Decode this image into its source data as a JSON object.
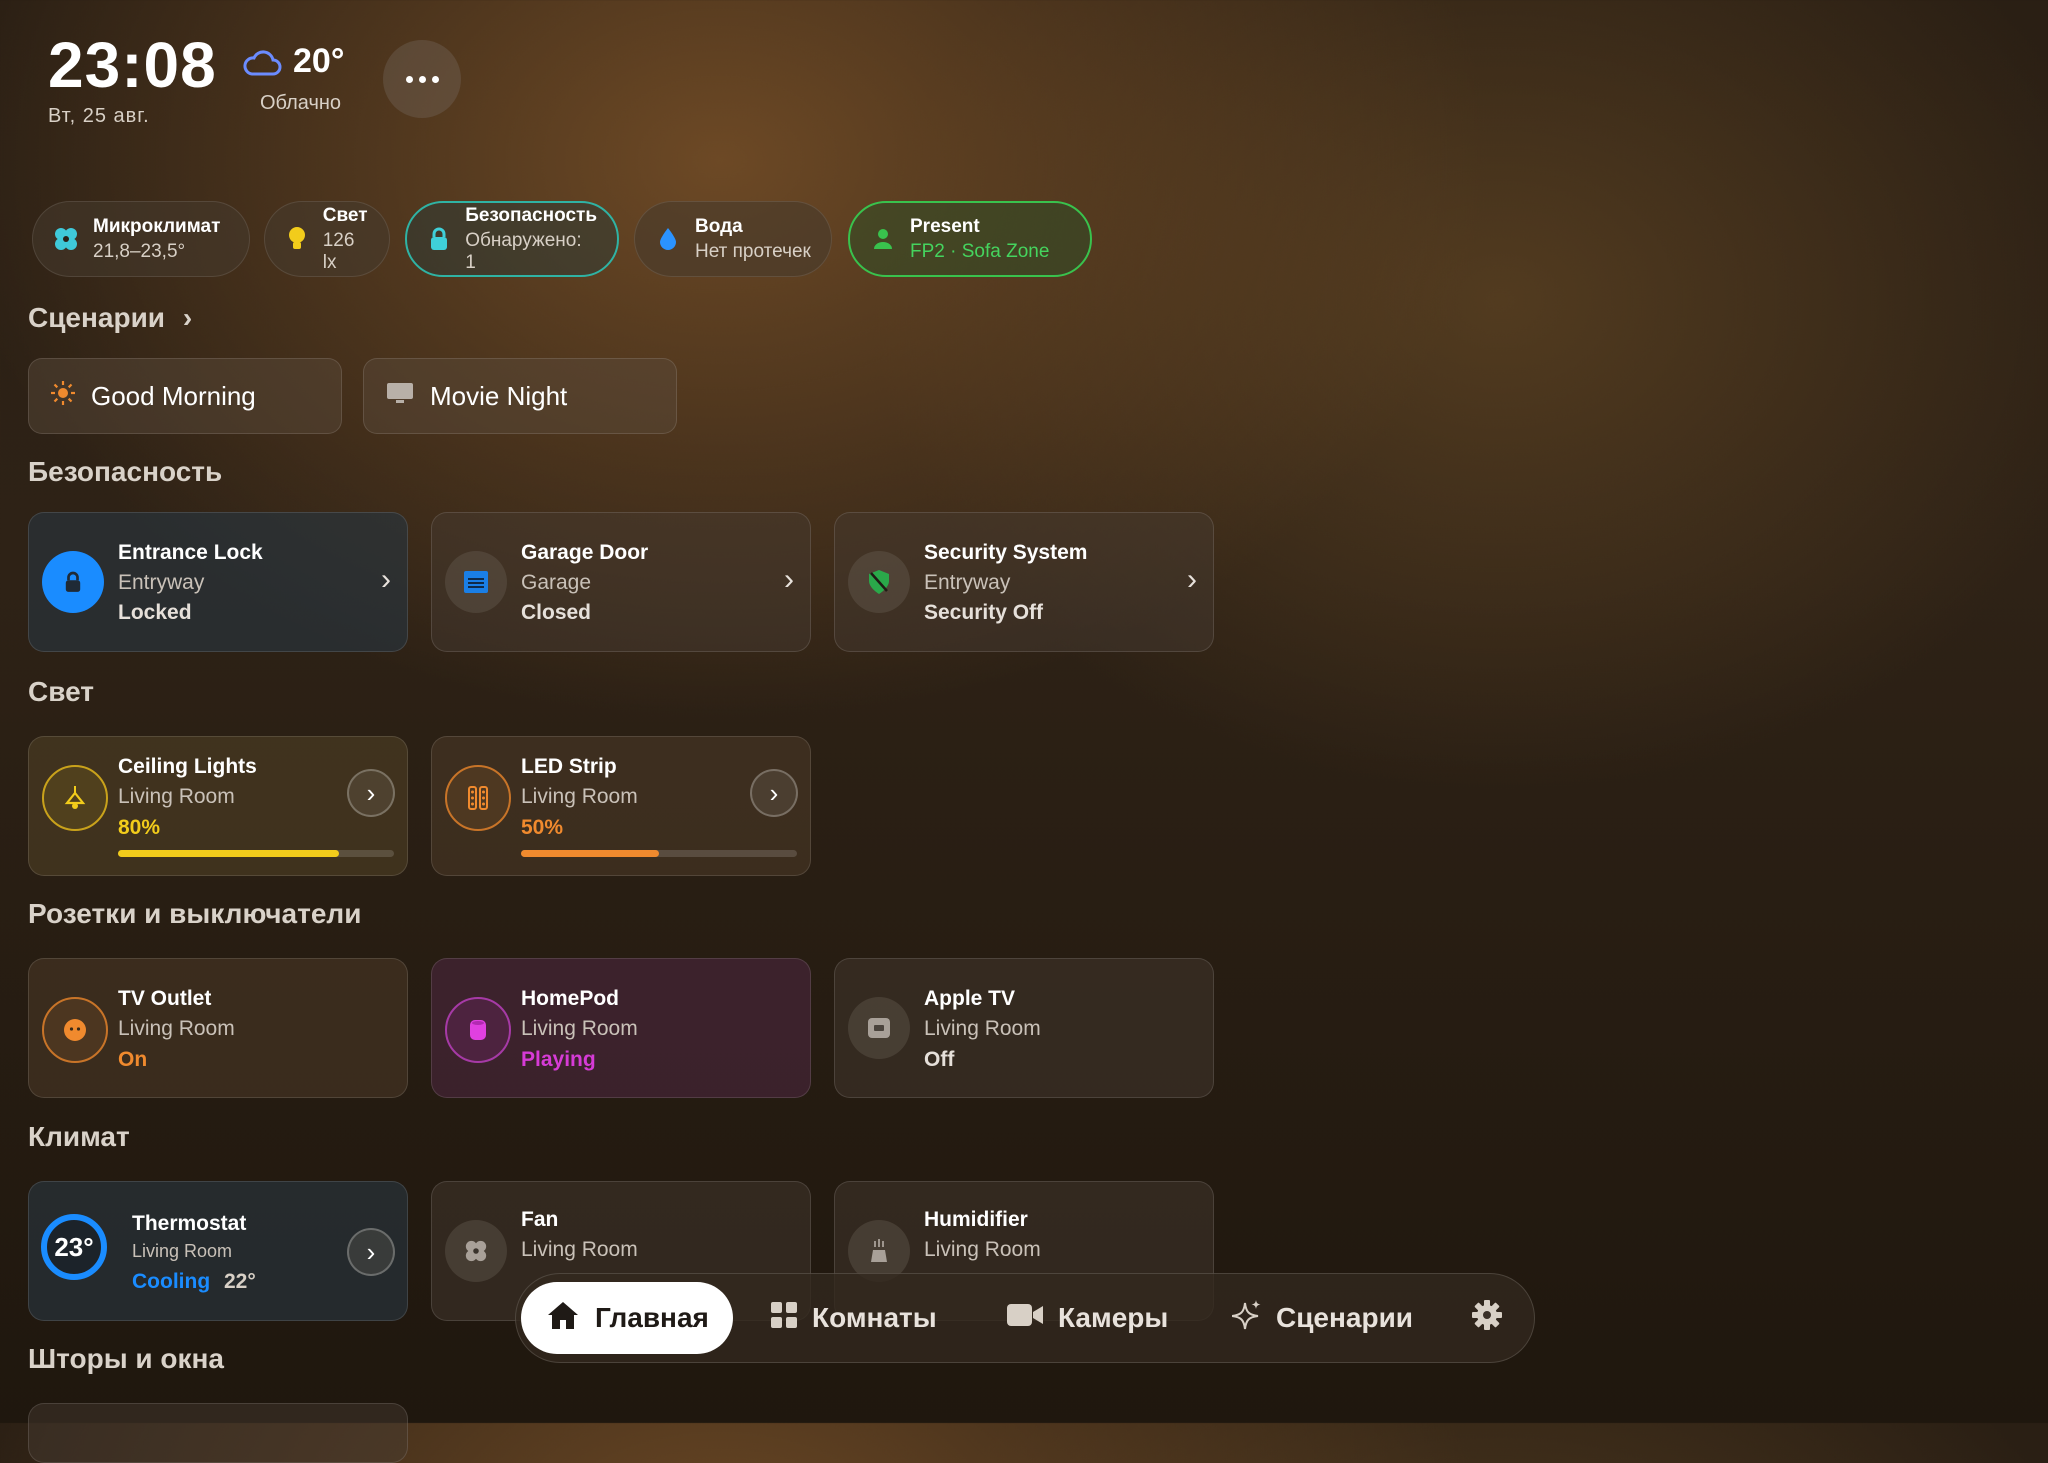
{
  "header": {
    "time": "23:08",
    "date": "Вт, 25 авг.",
    "temperature": "20°",
    "condition": "Облачно",
    "weather_icon": "cloud-icon",
    "more_icon": "ellipsis-icon"
  },
  "chips": [
    {
      "title": "Микроклимат",
      "value": "21,8–23,5°",
      "icon": "fan-icon"
    },
    {
      "title": "Свет",
      "value": "126 lx",
      "icon": "bulb-icon"
    },
    {
      "title": "Безопасность",
      "value": "Обнаружено: 1",
      "icon": "lock-icon"
    },
    {
      "title": "Вода",
      "value": "Нет протечек",
      "icon": "drop-icon"
    },
    {
      "title": "Present",
      "value": "FP2 · Sofa Zone",
      "icon": "person-icon"
    }
  ],
  "sections": {
    "scenes": "Сценарии",
    "security": "Безопасность",
    "lights": "Свет",
    "outlets": "Розетки и выключатели",
    "climate": "Климат",
    "blinds": "Шторы и окна"
  },
  "scenes": [
    {
      "label": "Good Morning",
      "icon": "sun-icon"
    },
    {
      "label": "Movie Night",
      "icon": "tv-icon"
    }
  ],
  "security": [
    {
      "name": "Entrance Lock",
      "room": "Entryway",
      "state": "Locked",
      "icon": "lock-icon"
    },
    {
      "name": "Garage Door",
      "room": "Garage",
      "state": "Closed",
      "icon": "garage-icon"
    },
    {
      "name": "Security System",
      "room": "Entryway",
      "state": "Security Off",
      "icon": "shield-icon"
    }
  ],
  "lights": [
    {
      "name": "Ceiling Lights",
      "room": "Living Room",
      "state": "80%",
      "level": 0.8,
      "color": "#f2cc1b",
      "icon": "ceiling-lamp-icon"
    },
    {
      "name": "LED Strip",
      "room": "Living Room",
      "state": "50%",
      "level": 0.5,
      "color": "#f08a2e",
      "icon": "led-strip-icon"
    }
  ],
  "outlets": [
    {
      "name": "TV Outlet",
      "room": "Living Room",
      "state": "On",
      "icon": "outlet-icon"
    },
    {
      "name": "HomePod",
      "room": "Living Room",
      "state": "Playing",
      "icon": "homepod-icon"
    },
    {
      "name": "Apple TV",
      "room": "Living Room",
      "state": "Off",
      "icon": "appletv-icon"
    }
  ],
  "climate": [
    {
      "name": "Thermostat",
      "room": "Living Room",
      "state": "Cooling",
      "target": "22°",
      "current": "23°"
    },
    {
      "name": "Fan",
      "room": "Living Room",
      "icon": "fan-icon"
    },
    {
      "name": "Humidifier",
      "room": "Living Room",
      "icon": "humidifier-icon"
    }
  ],
  "nav": [
    {
      "label": "Главная",
      "icon": "home-icon",
      "active": true
    },
    {
      "label": "Комнаты",
      "icon": "grid-icon"
    },
    {
      "label": "Камеры",
      "icon": "camera-icon"
    },
    {
      "label": "Сценарии",
      "icon": "sparkle-icon"
    },
    {
      "label": "",
      "icon": "gear-icon"
    }
  ],
  "colors": {
    "accent_blue": "#1a8cff",
    "teal": "#2fb3a4",
    "green": "#39c24d",
    "orange": "#f08a2e",
    "yellow": "#f2cc1b",
    "magenta": "#d63bd6"
  }
}
